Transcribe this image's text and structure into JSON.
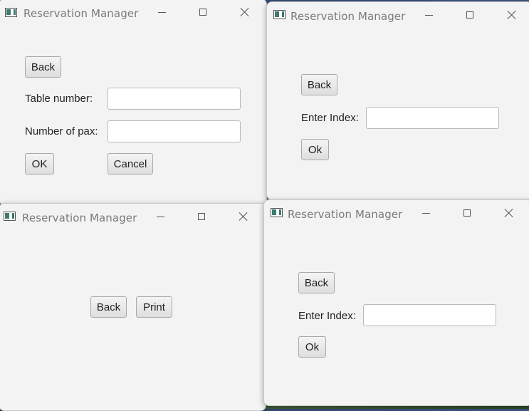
{
  "windows": [
    {
      "id": "table-window",
      "title": "Reservation Manager",
      "back_label": "Back",
      "table_number_label": "Table number:",
      "table_number_value": "",
      "pax_label": "Number of pax:",
      "pax_value": "",
      "ok_label": "OK",
      "cancel_label": "Cancel"
    },
    {
      "id": "index-window-top",
      "title": "Reservation Manager",
      "back_label": "Back",
      "index_label": "Enter Index:",
      "index_value": "",
      "ok_label": "Ok"
    },
    {
      "id": "print-window",
      "title": "Reservation Manager",
      "back_label": "Back",
      "print_label": "Print"
    },
    {
      "id": "index-window-bottom",
      "title": "Reservation Manager",
      "back_label": "Back",
      "index_label": "Enter Index:",
      "index_value": "",
      "ok_label": "Ok"
    }
  ],
  "icons": {
    "app": "app-window-icon",
    "minimize": "minimize-icon",
    "maximize": "maximize-icon",
    "close": "close-icon"
  }
}
